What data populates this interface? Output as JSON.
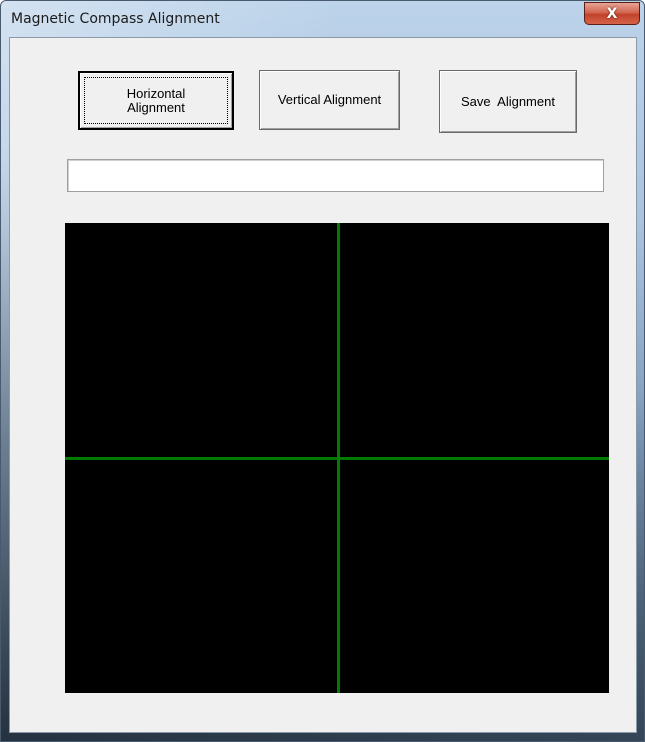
{
  "window": {
    "title": "Magnetic Compass Alignment",
    "close_glyph": "X"
  },
  "buttons": {
    "horizontal_label": "Horizontal Alignment",
    "vertical_label": "Vertical Alignment",
    "save_label": "Save  Alignment"
  },
  "status_field": {
    "value": ""
  },
  "display": {
    "background_color": "#000000",
    "crosshair_color": "#007a00"
  }
}
